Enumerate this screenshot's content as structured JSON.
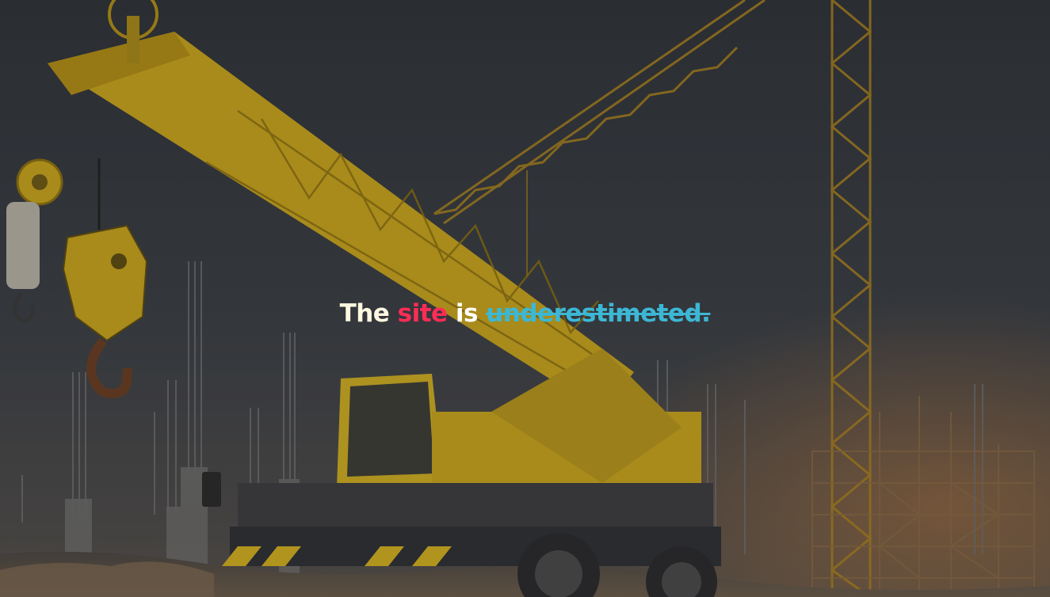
{
  "hero": {
    "headline": {
      "word_1": "The",
      "word_2": "site",
      "word_3": "is",
      "word_4": "underestimeted."
    },
    "colors": {
      "word_1": "#fff8e1",
      "word_2": "#ff2d55",
      "word_3": "#ffffff",
      "word_4": "#3cb7d4",
      "crane": "#d4b21c"
    },
    "background_image": "construction-site-crane-photo"
  }
}
